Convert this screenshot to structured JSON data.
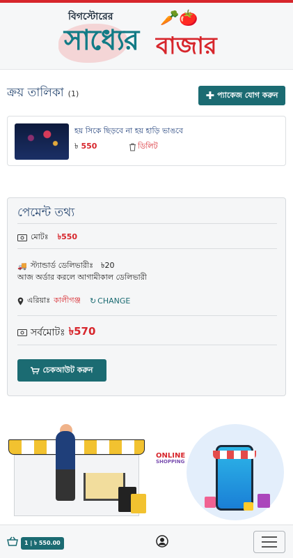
{
  "brand": {
    "tagline": "বিগস্টোরের",
    "name_part1": "সাধ্যের",
    "name_part2": "বাজার"
  },
  "cart": {
    "heading": "ক্রয় তালিকা",
    "count": "(1)",
    "add_package_label": "প্যাকেজ যোগ করুন",
    "items": [
      {
        "title": "হয় সিকে ছিড়বে না হয় হাড়ি ভাঙবে",
        "currency": "৳",
        "price": "550",
        "delete_label": "ডিলিট"
      }
    ]
  },
  "payment": {
    "heading": "পেমেন্ট তথ্য",
    "subtotal_label": "মোটঃ",
    "subtotal_value": "৳550",
    "delivery_label": "স্ট্যান্ডার্ড ডেলিভারীঃ",
    "delivery_value": "৳20",
    "delivery_note": "আজ অর্ডার করলে আগামীকাল ডেলিভারী",
    "area_label": "এরিয়াঃ",
    "area_value": "কালীগঞ্জ",
    "change_label": "CHANGE",
    "total_label": "সর্বমোটঃ",
    "total_value": "৳570",
    "checkout_label": "চেকআউট করুন"
  },
  "banner": {
    "online_text": "ONLINE",
    "shopping_text": "SHOPPING"
  },
  "bottom_bar": {
    "cart_summary": "1 | ৳ 550.00"
  },
  "colors": {
    "accent": "#1b6b72",
    "price": "#d7262c",
    "heading": "#2b4a73"
  }
}
